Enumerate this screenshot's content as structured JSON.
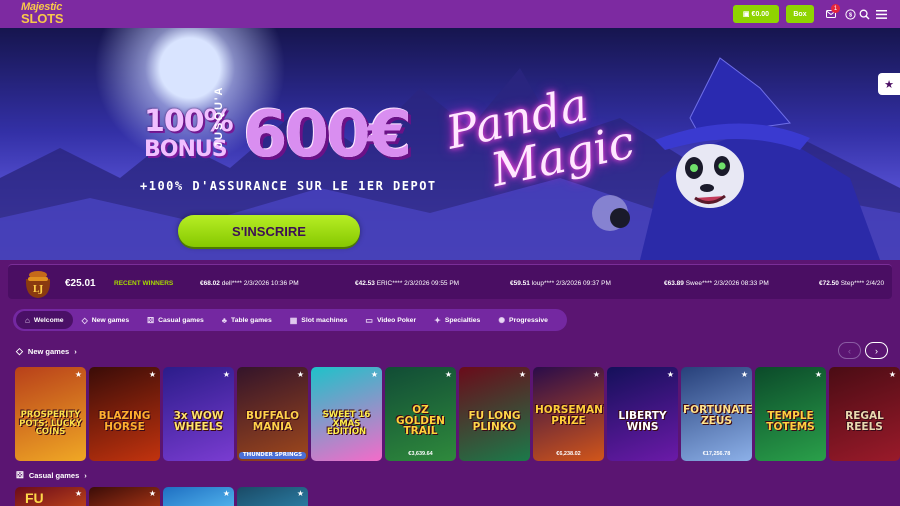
{
  "header": {
    "logo_line1": "Majestic",
    "logo_line2": "SLOTS",
    "balance_label": "€0.00",
    "box_label": "Box",
    "notification_count": "1"
  },
  "banner": {
    "bonus_percent": "100%",
    "bonus_word": "BONUS",
    "up_to": "JUSQU'A",
    "amount": "600€",
    "subline": "+100% D'ASSURANCE SUR LE 1ER DEPOT",
    "cta_label": "S'INSCRIRE",
    "game_title_line1": "Panda",
    "game_title_line2": "Magic",
    "slide_count": 4,
    "active_slide": 3
  },
  "jackpot": {
    "icon_text": "LJ",
    "amount": "€25.01",
    "recent_winners_label": "RECENT WINNERS",
    "winners": [
      {
        "amount": "€68.02",
        "user": "dell****",
        "date": "2/3/2026 10:36 PM"
      },
      {
        "amount": "€42.53",
        "user": "ERIC****",
        "date": "2/3/2026 09:55 PM"
      },
      {
        "amount": "€59.51",
        "user": "loup****",
        "date": "2/3/2026 09:37 PM"
      },
      {
        "amount": "€63.89",
        "user": "Swee****",
        "date": "2/3/2026 08:33 PM"
      },
      {
        "amount": "€72.50",
        "user": "Step****",
        "date": "2/4/20"
      }
    ]
  },
  "tabs": [
    {
      "label": "Welcome",
      "icon": "home-icon",
      "glyph": "⌂"
    },
    {
      "label": "New games",
      "icon": "diamond-icon",
      "glyph": "◇"
    },
    {
      "label": "Casual games",
      "icon": "dice-icon",
      "glyph": "⚄"
    },
    {
      "label": "Table games",
      "icon": "clubs-icon",
      "glyph": "♣"
    },
    {
      "label": "Slot machines",
      "icon": "slot-icon",
      "glyph": "▦"
    },
    {
      "label": "Video Poker",
      "icon": "card-icon",
      "glyph": "▭"
    },
    {
      "label": "Specialties",
      "icon": "sparkle-icon",
      "glyph": "✦"
    },
    {
      "label": "Progressive",
      "icon": "gear-icon",
      "glyph": "✺"
    }
  ],
  "sections": {
    "new_games_title": "New games",
    "casual_games_title": "Casual games"
  },
  "games": [
    {
      "name": "PROSPERITY POTS: LUCKY COINS",
      "jackpot": "",
      "bg1": "#b8401a",
      "bg2": "#f0a825",
      "fg": "#ffe34a"
    },
    {
      "name": "BLAZING HORSE",
      "jackpot": "",
      "bg1": "#3a0c08",
      "bg2": "#c2330e",
      "fg": "#ffb02e"
    },
    {
      "name": "3x WOW WHEELS",
      "jackpot": "",
      "bg1": "#2b1c8a",
      "bg2": "#7a3cd1",
      "fg": "#ffe46b"
    },
    {
      "name": "BUFFALO MANIA",
      "subtitle": "THUNDER SPRINGS",
      "jackpot": "",
      "bg1": "#33142a",
      "bg2": "#a0481c",
      "fg": "#ffd24a"
    },
    {
      "name": "SWEET 16 XMAS EDITION",
      "jackpot": "",
      "bg1": "#1ec2c9",
      "bg2": "#f46bc9",
      "fg": "#ffef4a"
    },
    {
      "name": "OZ GOLDEN TRAIL",
      "jackpot": "€3,639.64",
      "bg1": "#114c36",
      "bg2": "#2f8a3c",
      "fg": "#ffd23a"
    },
    {
      "name": "FU LONG PLINKO",
      "jackpot": "",
      "bg1": "#6a0b1a",
      "bg2": "#1b7a4a",
      "fg": "#ffd84a"
    },
    {
      "name": "HORSEMAN'S PRIZE",
      "jackpot": "€6,238.02",
      "bg1": "#2a0c4a",
      "bg2": "#d2561a",
      "fg": "#ffcf3a"
    },
    {
      "name": "LIBERTY WINS",
      "jackpot": "",
      "bg1": "#14105a",
      "bg2": "#6b1aa8",
      "fg": "#ffffff"
    },
    {
      "name": "FORTUNATE ZEUS",
      "jackpot": "€17,256.78",
      "bg1": "#27407a",
      "bg2": "#8cb0e8",
      "fg": "#ffe28a"
    },
    {
      "name": "TEMPLE TOTEMS",
      "jackpot": "",
      "bg1": "#0b4a2a",
      "bg2": "#2aa04a",
      "fg": "#ffd040"
    },
    {
      "name": "REGAL REELS",
      "jackpot": "",
      "bg1": "#4a0c14",
      "bg2": "#9a1a2a",
      "fg": "#e8d8b0"
    }
  ],
  "casual_games": [
    {
      "name": "FU",
      "bg1": "#6a0b1a",
      "bg2": "#b8401a"
    },
    {
      "name": "",
      "bg1": "#3a0c08",
      "bg2": "#a03214"
    },
    {
      "name": "",
      "bg1": "#1e6fc2",
      "bg2": "#4fb0ea"
    },
    {
      "name": "",
      "bg1": "#1a4a66",
      "bg2": "#2a7aa0"
    }
  ],
  "colors": {
    "page_bg": "#5b1572",
    "header_bg": "#7d2aa1",
    "accent_green": "#8fd400",
    "recent_winners_green": "#a6d900",
    "notification_red": "#e5263a"
  }
}
